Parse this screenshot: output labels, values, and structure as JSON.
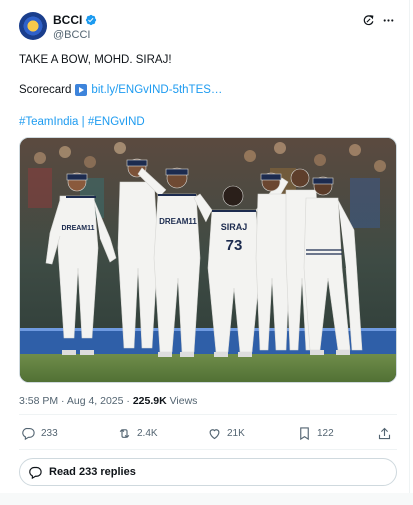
{
  "tweet": {
    "display_name": "BCCI",
    "handle": "@BCCI",
    "headline": "TAKE A BOW, MOHD. SIRAJ!",
    "scorecard_label": "Scorecard",
    "scorecard_link": "bit.ly/ENGvIND-5thTES…",
    "hashtags": "#TeamIndia | #ENGvIND",
    "timestamp": "3:58 PM · Aug 4, 2025 · ",
    "views_count": "225.9K",
    "views_label": " Views"
  },
  "actions": {
    "replies": "233",
    "reposts": "2.4K",
    "likes": "21K",
    "bookmarks": "122"
  },
  "read_replies": "Read 233 replies",
  "image": {
    "shirt_text_left": "DREAM11",
    "shirt_text_center": "DREAM11",
    "back_name": "SIRAJ",
    "back_number": "73"
  },
  "colors": {
    "accent": "#1d9bf0",
    "verified": "#1d9bf0",
    "text": "#0f1419",
    "muted": "#536471"
  }
}
